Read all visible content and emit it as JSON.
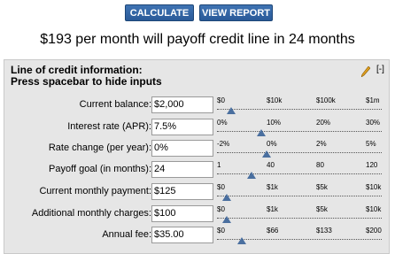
{
  "toolbar": {
    "calculate_label": "CALCULATE",
    "view_report_label": "VIEW REPORT"
  },
  "headline": "$193 per month will payoff credit line in 24 months",
  "panel": {
    "title_line1": "Line of credit information:",
    "title_line2": "Press spacebar to hide inputs",
    "collapse_label": "[-]"
  },
  "colors": {
    "button": "#2f63a3",
    "panel_bg": "#e6e6e6",
    "slider_thumb": "#4a6f9f",
    "pencil": "#e0a020"
  },
  "rows": [
    {
      "label": "Current balance:",
      "value": "$2,000",
      "ticks": [
        "$0",
        "$10k",
        "$100k",
        "$1m"
      ]
    },
    {
      "label": "Interest rate (APR):",
      "value": "7.5%",
      "ticks": [
        "0%",
        "10%",
        "20%",
        "30%"
      ]
    },
    {
      "label": "Rate change (per year):",
      "value": "0%",
      "ticks": [
        "-2%",
        "0%",
        "2%",
        "5%"
      ]
    },
    {
      "label": "Payoff goal (in months):",
      "value": "24",
      "ticks": [
        "1",
        "40",
        "80",
        "120"
      ]
    },
    {
      "label": "Current monthly payment:",
      "value": "$125",
      "ticks": [
        "$0",
        "$1k",
        "$5k",
        "$10k"
      ]
    },
    {
      "label": "Additional monthly charges:",
      "value": "$100",
      "ticks": [
        "$0",
        "$1k",
        "$5k",
        "$10k"
      ]
    },
    {
      "label": "Annual fee:",
      "value": "$35.00",
      "ticks": [
        "$0",
        "$66",
        "$133",
        "$200"
      ]
    }
  ]
}
